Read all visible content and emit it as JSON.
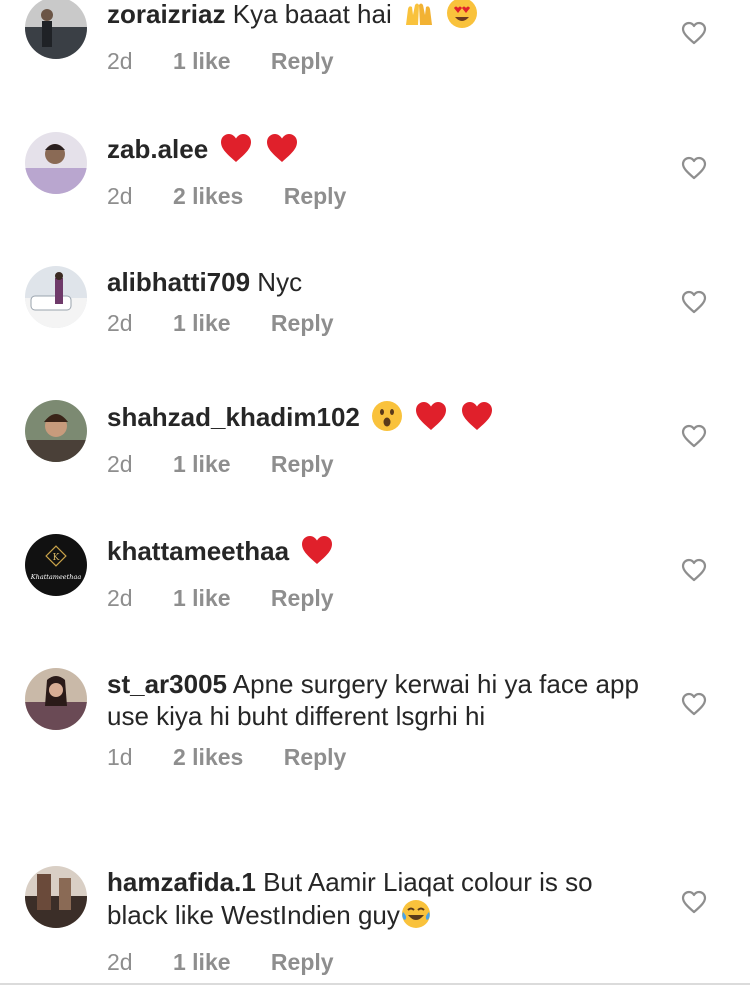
{
  "comments": [
    {
      "username": "zoraizriaz",
      "text": "Kya baaat hai",
      "emojis": [
        "raised-hands",
        "heart-eyes"
      ],
      "time": "2d",
      "likes": "1 like",
      "reply": "Reply",
      "avatar_color": "#3a3f45"
    },
    {
      "username": "zab.alee",
      "text": "",
      "emojis": [
        "red-heart",
        "red-heart"
      ],
      "time": "2d",
      "likes": "2 likes",
      "reply": "Reply",
      "avatar_color": "#b9a6cf"
    },
    {
      "username": "alibhatti709",
      "text": "Nyc",
      "emojis": [],
      "time": "2d",
      "likes": "1 like",
      "reply": "Reply",
      "avatar_color": "#6f7e91"
    },
    {
      "username": "shahzad_khadim102",
      "text": "",
      "emojis": [
        "astonished-face",
        "red-heart",
        "red-heart"
      ],
      "time": "2d",
      "likes": "1 like",
      "reply": "Reply",
      "avatar_color": "#4a4038"
    },
    {
      "username": "khattameethaa",
      "text": "",
      "emojis": [
        "red-heart"
      ],
      "time": "2d",
      "likes": "1 like",
      "reply": "Reply",
      "avatar_color": "#111111",
      "avatar_text": "Khattameethaa",
      "avatar_letter": "K"
    },
    {
      "username": "st_ar3005",
      "text": "Apne surgery kerwai hi ya face app use kiya hi buht different lsgrhi hi",
      "emojis": [],
      "time": "1d",
      "likes": "2 likes",
      "reply": "Reply",
      "avatar_color": "#6a4a55"
    },
    {
      "username": "hamzafida.1",
      "text": "But Aamir Liaqat colour is so black like WestIndien guy",
      "emojis": [
        "tears-of-joy"
      ],
      "time": "2d",
      "likes": "1 like",
      "reply": "Reply",
      "avatar_color": "#3b2e28"
    }
  ],
  "colors": {
    "text": "#262626",
    "meta": "#8e8e8e",
    "heart_red": "#e0202b",
    "emoji_yellow": "#f9c23c"
  }
}
